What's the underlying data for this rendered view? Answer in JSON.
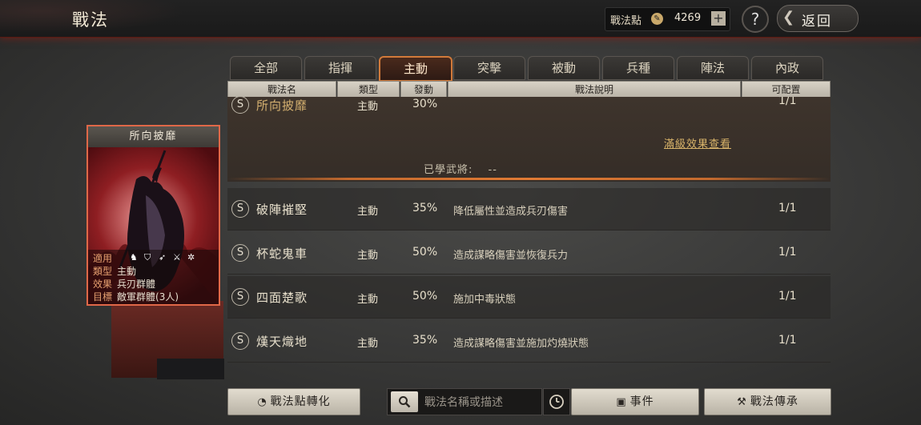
{
  "header": {
    "title": "戰法",
    "points_label": "戰法點",
    "points_value": "4269",
    "add_symbol": "+",
    "help_symbol": "?",
    "back_label": "返回"
  },
  "tabs": [
    {
      "label": "全部"
    },
    {
      "label": "指揮"
    },
    {
      "label": "主動"
    },
    {
      "label": "突擊"
    },
    {
      "label": "被動"
    },
    {
      "label": "兵種"
    },
    {
      "label": "陣法"
    },
    {
      "label": "內政"
    }
  ],
  "active_tab": "主動",
  "columns": [
    "戰法名",
    "類型",
    "發動",
    "戰法說明",
    "可配置"
  ],
  "expanded": {
    "grade": "S",
    "name": "所向披靡",
    "type": "主動",
    "rate": "30%",
    "count": "1/1",
    "full_effect_link": "滿級效果查看",
    "learned_label": "已學武將:",
    "learned_value": "--"
  },
  "rows": [
    {
      "grade": "S",
      "name": "破陣摧堅",
      "type": "主動",
      "rate": "35%",
      "desc": "降低屬性並造成兵刃傷害",
      "count": "1/1"
    },
    {
      "grade": "S",
      "name": "杯蛇鬼車",
      "type": "主動",
      "rate": "50%",
      "desc": "造成謀略傷害並恢復兵力",
      "count": "1/1"
    },
    {
      "grade": "S",
      "name": "四面楚歌",
      "type": "主動",
      "rate": "50%",
      "desc": "施加中毒狀態",
      "count": "1/1"
    },
    {
      "grade": "S",
      "name": "熯天熾地",
      "type": "主動",
      "rate": "35%",
      "desc": "造成謀略傷害並施加灼燒狀態",
      "count": "1/1"
    }
  ],
  "card": {
    "title": "所向披靡",
    "applicable_key": "適用",
    "type_key": "類型",
    "type_value": "主動",
    "effect_key": "效果",
    "effect_value": "兵刃群體",
    "target_key": "目標",
    "target_value": "敵軍群體(3人)",
    "unit_icons": [
      "cavalry-icon",
      "shield-icon",
      "archer-icon",
      "spear-icon",
      "siege-icon"
    ]
  },
  "footer": {
    "convert_label": "戰法點轉化",
    "search_placeholder": "戰法名稱或描述",
    "events_label": "事件",
    "inherit_label": "戰法傳承"
  },
  "colors": {
    "accent_orange": "#e07a34",
    "card_border": "#e06848",
    "link_gold": "#d9b46a"
  }
}
